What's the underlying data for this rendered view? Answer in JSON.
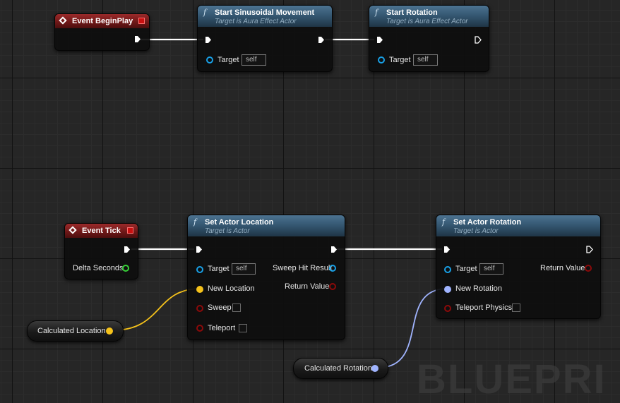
{
  "watermark": "BLUEPRI",
  "nodes": {
    "begin_play": {
      "title": "Event BeginPlay"
    },
    "start_sinusoidal": {
      "title": "Start Sinusoidal Movement",
      "subtitle": "Target is Aura Effect Actor",
      "target_label": "Target",
      "target_value": "self"
    },
    "start_rotation": {
      "title": "Start Rotation",
      "subtitle": "Target is Aura Effect Actor",
      "target_label": "Target",
      "target_value": "self"
    },
    "event_tick": {
      "title": "Event Tick",
      "delta_label": "Delta Seconds"
    },
    "set_actor_location": {
      "title": "Set Actor Location",
      "subtitle": "Target is Actor",
      "target_label": "Target",
      "target_value": "self",
      "new_location_label": "New Location",
      "sweep_label": "Sweep",
      "teleport_label": "Teleport",
      "sweep_hit_label": "Sweep Hit Result",
      "return_label": "Return Value"
    },
    "set_actor_rotation": {
      "title": "Set Actor Rotation",
      "subtitle": "Target is Actor",
      "target_label": "Target",
      "target_value": "self",
      "new_rotation_label": "New Rotation",
      "teleport_physics_label": "Teleport Physics",
      "return_label": "Return Value"
    },
    "calc_location": {
      "label": "Calculated Location"
    },
    "calc_rotation": {
      "label": "Calculated Rotation"
    }
  },
  "colors": {
    "exec": "#ffffff",
    "object_pin": "#18a0e6",
    "vector_pin": "#f5c21b",
    "rotator_pin": "#a0b4ff",
    "bool_pin": "#8c0a0a",
    "float_pin": "#36d137"
  }
}
